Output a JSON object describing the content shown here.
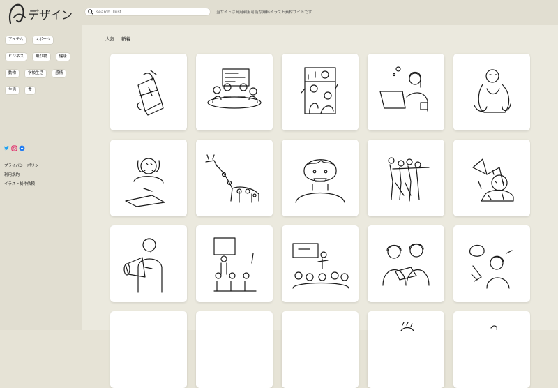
{
  "header": {
    "logo_text": "デザイン",
    "search_placeholder": "search illust",
    "tagline": "当サイトは商用利用可能な無料イラスト素材サイトです"
  },
  "sidebar": {
    "tags": [
      "アイテム",
      "スポーツ",
      "ビジネス",
      "乗り物",
      "健康",
      "動物",
      "学校生活",
      "感情",
      "生活",
      "食"
    ],
    "social": [
      "twitter-icon",
      "instagram-icon",
      "facebook-icon"
    ],
    "links": [
      "プライバシーポリシー",
      "利用規約",
      "イラスト制作依頼"
    ]
  },
  "main": {
    "tabs": [
      "人気",
      "新着"
    ],
    "illustrations": [
      "backpack",
      "meeting",
      "train-passengers",
      "woman-laptop",
      "gorilla",
      "stressed-student",
      "giraffe",
      "boy-face",
      "dancers",
      "tiger",
      "man-megaphone",
      "presentation-class",
      "lecture-audience",
      "two-women-document",
      "women-thinking",
      "partial-1",
      "partial-2",
      "partial-3",
      "partial-4",
      "partial-5"
    ]
  },
  "colors": {
    "background": "#e6e3d6",
    "card": "#ffffff",
    "twitter": "#1da1f2",
    "instagram": "#e1306c",
    "facebook": "#1877f2"
  }
}
